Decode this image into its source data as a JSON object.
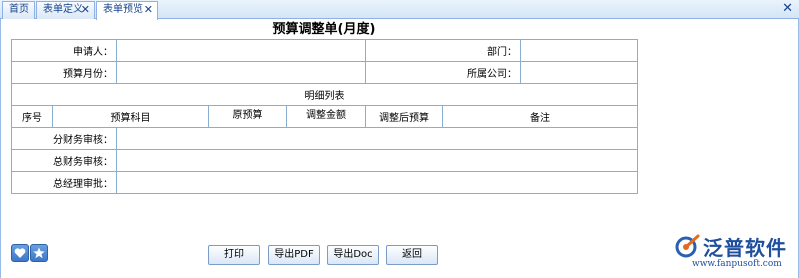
{
  "tabs": [
    {
      "label": "首页",
      "closable": false
    },
    {
      "label": "表单定义",
      "closable": true
    },
    {
      "label": "表单预览",
      "closable": true,
      "active": true
    }
  ],
  "form": {
    "title": "预算调整单(月度)",
    "applicant_label": "申请人：",
    "department_label": "部门：",
    "budget_month_label": "预算月份：",
    "company_label": "所属公司：",
    "detail_list_label": "明细列表",
    "detail_columns": [
      "序号",
      "预算科目",
      "原预算",
      "调整金额",
      "调整后预算",
      "备注"
    ],
    "branch_finance_review_label": "分财务审核：",
    "head_finance_review_label": "总财务审核：",
    "gm_approval_label": "总经理审批："
  },
  "buttons": {
    "print": "打印",
    "export_pdf": "导出PDF",
    "export_doc": "导出Doc",
    "back": "返回"
  },
  "icons": [
    "heart-icon",
    "star-icon"
  ],
  "logo": {
    "name": "泛普软件",
    "url": "www.fanpusoft.com"
  }
}
